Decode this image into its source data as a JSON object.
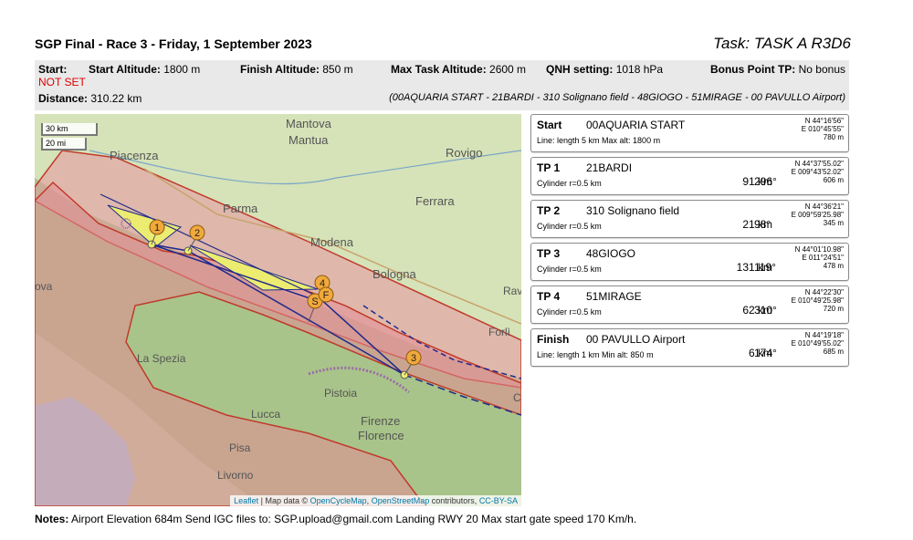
{
  "header": {
    "title": "SGP Final - Race 3 - Friday, 1 September 2023",
    "task": "Task: TASK A R3D6"
  },
  "info": {
    "start_label": "Start:",
    "start_value": "NOT SET",
    "start_alt_label": "Start Altitude:",
    "start_alt_value": "1800 m",
    "finish_alt_label": "Finish Altitude:",
    "finish_alt_value": "850 m",
    "max_alt_label": "Max Task Altitude:",
    "max_alt_value": "2600 m",
    "qnh_label": "QNH setting:",
    "qnh_value": "1018 hPa",
    "bonus_label": "Bonus Point TP:",
    "bonus_value": "No bonus",
    "distance_label": "Distance:",
    "distance_value": "310.22 km",
    "route": "(00AQUARIA START - 21BARDI - 310 Solignano field - 48GIOGO - 51MIRAGE - 00 PAVULLO Airport)"
  },
  "map": {
    "scale_km": "30 km",
    "scale_mi": "20 mi",
    "cities": [
      "Mantova",
      "Mantua",
      "Rovigo",
      "Piacenza",
      "Parma",
      "Ferrara",
      "Modena",
      "Bologna",
      "Rav",
      "ova",
      "Forlì",
      "La Spezia",
      "Pistoia",
      "Firenze",
      "Florence",
      "Lucca",
      "Pisa",
      "Livorno",
      "C"
    ],
    "markers": [
      "1",
      "2",
      "3",
      "4",
      "S",
      "F"
    ],
    "attribution": {
      "leaflet": "Leaflet",
      "sep": "| Map data ©",
      "ocm": "OpenCycleMap",
      "comma": ",",
      "osm": "OpenStreetMap",
      "contrib": "contributors,",
      "license": "CC-BY-SA"
    },
    "colors": {
      "zone_fill": "#e8a0a8",
      "zone_stroke": "#c0392b",
      "route": "#1f2a8a",
      "sector": "#ecec70",
      "marker": "#f2a93b"
    }
  },
  "turnpoints": [
    {
      "label": "Start",
      "name": "00AQUARIA START",
      "sub": "Line: length 5 km      Max alt: 1800 m",
      "dist": "",
      "bearing": "",
      "lat": "N 44°16'56\"",
      "lon": "E 010°45'55\"",
      "elev": "780 m"
    },
    {
      "label": "TP 1",
      "name": "21BARDI",
      "sub": "Cylinder r=0.5 km",
      "dist": "91 km",
      "bearing": "296°",
      "lat": "N 44°37'55.02\"",
      "lon": "E 009°43'52.02\"",
      "elev": "606 m"
    },
    {
      "label": "TP 2",
      "name": "310 Solignano field",
      "sub": "Cylinder r=0.5 km",
      "dist": "21 km",
      "bearing": "98°",
      "lat": "N 44°36'21\"",
      "lon": "E 009°59'25.98\"",
      "elev": "345 m"
    },
    {
      "label": "TP 3",
      "name": "48GIOGO",
      "sub": "Cylinder r=0.5 km",
      "dist": "131 km",
      "bearing": "119°",
      "lat": "N 44°01'10.98\"",
      "lon": "E 011°24'51\"",
      "elev": "478 m"
    },
    {
      "label": "TP 4",
      "name": "51MIRAGE",
      "sub": "Cylinder r=0.5 km",
      "dist": "62 km",
      "bearing": "310°",
      "lat": "N 44°22'30\"",
      "lon": "E 010°49'25.98\"",
      "elev": "720 m"
    },
    {
      "label": "Finish",
      "name": "00 PAVULLO Airport",
      "sub": "Line: length 1 km      Min alt: 850 m",
      "dist": "6 km",
      "bearing": "174°",
      "lat": "N 44°19'18\"",
      "lon": "E 010°49'55.02\"",
      "elev": "685 m"
    }
  ],
  "notes": {
    "label": "Notes:",
    "text": "Airport Elevation 684m Send IGC files to:        SGP.upload@gmail.com  Landing RWY 20 Max start gate speed 170 Km/h."
  }
}
